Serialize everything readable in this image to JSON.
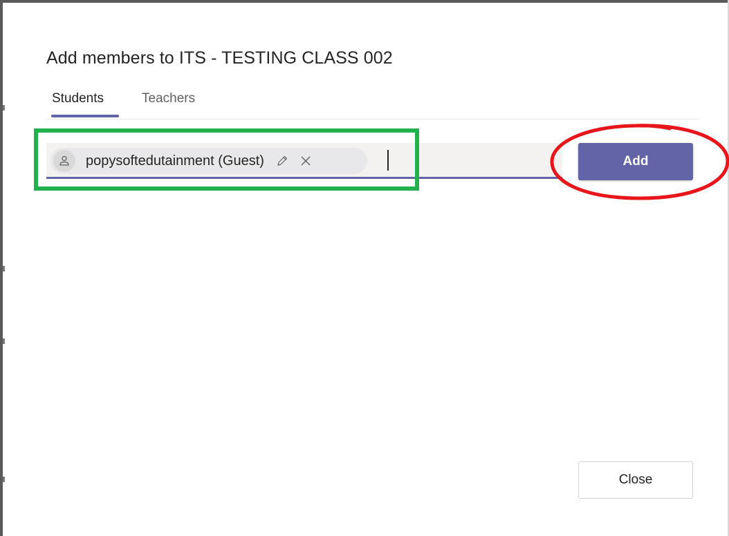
{
  "dialog": {
    "title": "Add members to ITS - TESTING CLASS 002"
  },
  "tabs": [
    {
      "label": "Students",
      "selected": true
    },
    {
      "label": "Teachers",
      "selected": false
    }
  ],
  "picker": {
    "selected_member": {
      "name": "popysoftedutainment (Guest)",
      "avatar_icon": "person-icon",
      "edit_icon": "pencil-icon",
      "remove_icon": "close-icon"
    },
    "input_value": ""
  },
  "buttons": {
    "add_label": "Add",
    "close_label": "Close"
  },
  "colors": {
    "accent": "#6264a7",
    "highlight_green": "#22b14c",
    "highlight_red": "#e8161b"
  }
}
